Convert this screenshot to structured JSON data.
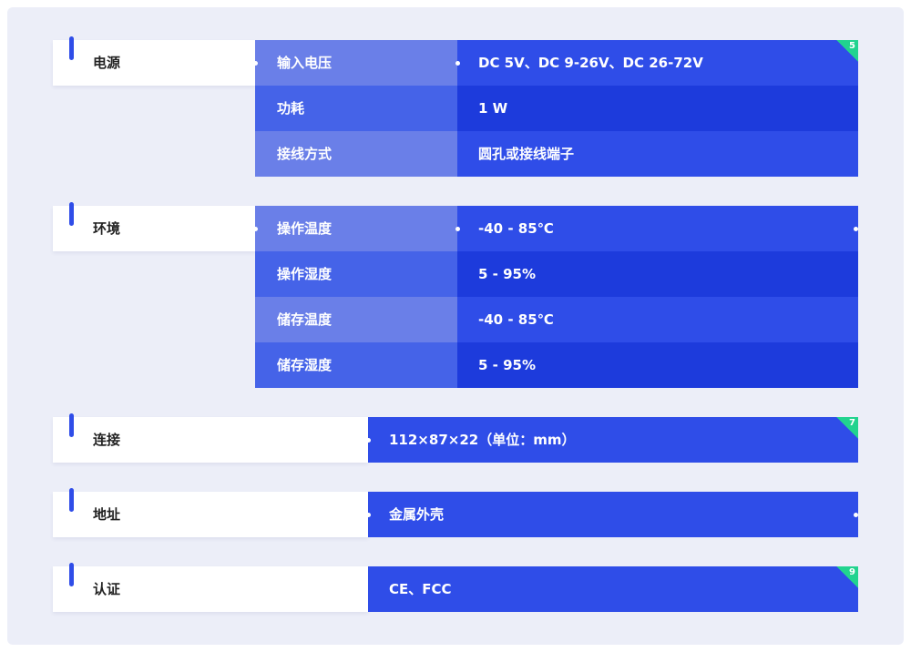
{
  "colors": {
    "background": "#eceef8",
    "key_light": "#6a7fe8",
    "key_dark": "#4563e8",
    "value_light": "#2f4de8",
    "value_dark": "#1d3bdc",
    "accent_bar": "#2f4de8",
    "badge": "#21d38f"
  },
  "sections": [
    {
      "category": "电源",
      "badge": "5",
      "rows": [
        {
          "key": "输入电压",
          "value": "DC 5V、DC 9-26V、DC 26-72V"
        },
        {
          "key": "功耗",
          "value": "1 W"
        },
        {
          "key": "接线方式",
          "value": "圆孔或接线端子"
        }
      ]
    },
    {
      "category": "环境",
      "rows": [
        {
          "key": "操作温度",
          "value": "-40 - 85℃"
        },
        {
          "key": "操作湿度",
          "value": "5 - 95%"
        },
        {
          "key": "储存温度",
          "value": "-40 - 85℃"
        },
        {
          "key": "储存湿度",
          "value": "5 - 95%"
        }
      ]
    },
    {
      "category": "连接",
      "badge": "7",
      "value": "112×87×22（单位：mm）"
    },
    {
      "category": "地址",
      "value": "金属外壳"
    },
    {
      "category": "认证",
      "badge": "9",
      "value": "CE、FCC"
    }
  ]
}
